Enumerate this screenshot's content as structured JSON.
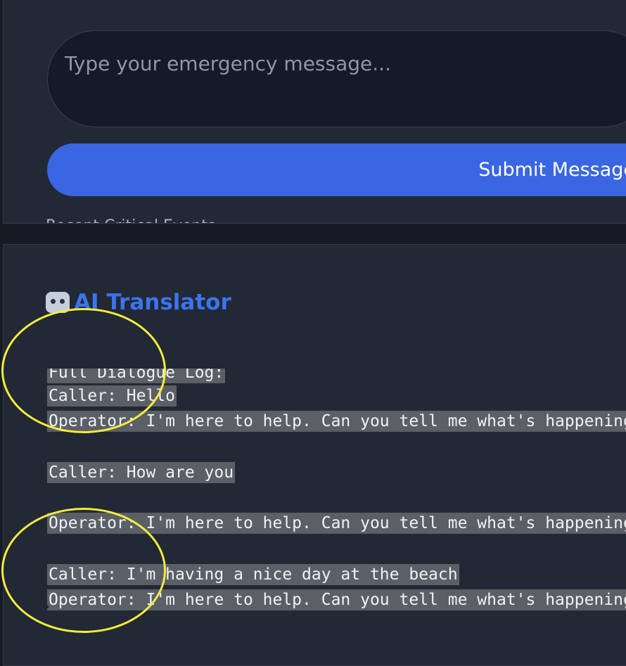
{
  "emergency_form": {
    "message_placeholder": "Type your emergency message...",
    "submit_label": "Submit Message",
    "below_label": "Recent Critical Events"
  },
  "translator": {
    "title": "AI Translator",
    "icon": "robot-icon",
    "log_header": "Full Dialogue Log:",
    "log_lines": [
      "Caller: Hello",
      "Operator: I'm here to help. Can you tell me what's happening?",
      "",
      "Caller: How are you",
      "",
      "Operator: I'm here to help. Can you tell me what's happening?",
      "",
      "Caller: I'm having a nice day at the beach",
      "Operator: I'm here to help. Can you tell me what's happening?"
    ]
  },
  "colors": {
    "accent": "#3a66e3",
    "title_blue": "#3b74f0",
    "annotation_yellow": "#f3ec3f"
  }
}
